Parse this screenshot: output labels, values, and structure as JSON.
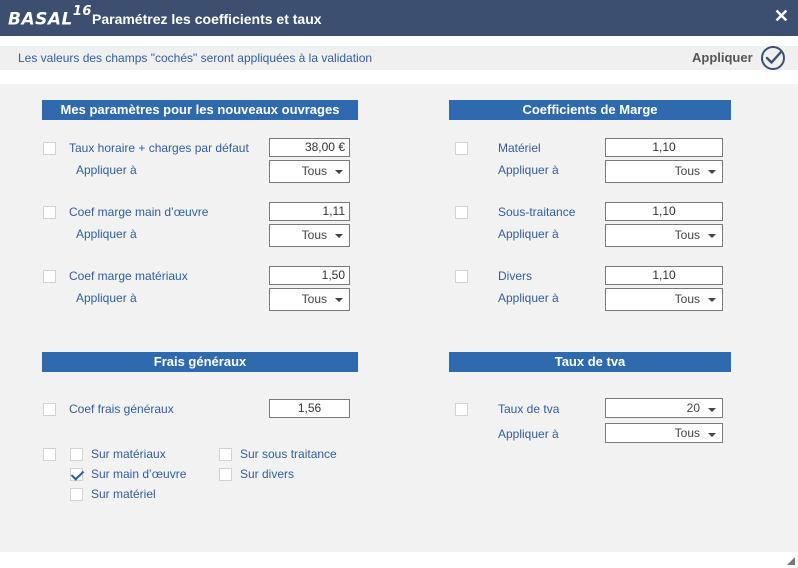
{
  "window": {
    "logo": "BASAL",
    "logo_version": "16",
    "title": "Paramétrez les coefficients et taux"
  },
  "info": {
    "text": "Les valeurs des champs \"cochés\" seront appliquées à la validation",
    "apply_label": "Appliquer"
  },
  "sections": {
    "params_title": "Mes paramètres pour les nouveaux ouvrages",
    "marge_title": "Coefficients de Marge",
    "frais_title": "Frais généraux",
    "tva_title": "Taux de tva"
  },
  "params": {
    "apply_label": "Appliquer à",
    "taux_horaire": {
      "label": "Taux horaire + charges par défaut",
      "value": "38,00 €",
      "apply": "Tous"
    },
    "coef_mo": {
      "label": "Coef marge main d’œuvre",
      "value": "1,11",
      "apply": "Tous"
    },
    "coef_mat": {
      "label": "Coef marge matériaux",
      "value": "1,50",
      "apply": "Tous"
    }
  },
  "marge": {
    "apply_label": "Appliquer à",
    "materiel": {
      "label": "Matériel",
      "value": "1,10",
      "apply": "Tous"
    },
    "sous_traitance": {
      "label": "Sous-traitance",
      "value": "1,10",
      "apply": "Tous"
    },
    "divers": {
      "label": "Divers",
      "value": "1,10",
      "apply": "Tous"
    }
  },
  "frais": {
    "coef_label": "Coef frais généraux",
    "coef_value": "1,56",
    "options": [
      {
        "label": "Sur matériaux",
        "checked": false
      },
      {
        "label": "Sur main d’œuvre",
        "checked": true
      },
      {
        "label": "Sur matériel",
        "checked": false
      },
      {
        "label": "Sur sous traitance",
        "checked": false
      },
      {
        "label": "Sur divers",
        "checked": false
      }
    ]
  },
  "tva": {
    "label": "Taux de tva",
    "value": "20",
    "apply_label": "Appliquer à",
    "apply": "Tous"
  }
}
